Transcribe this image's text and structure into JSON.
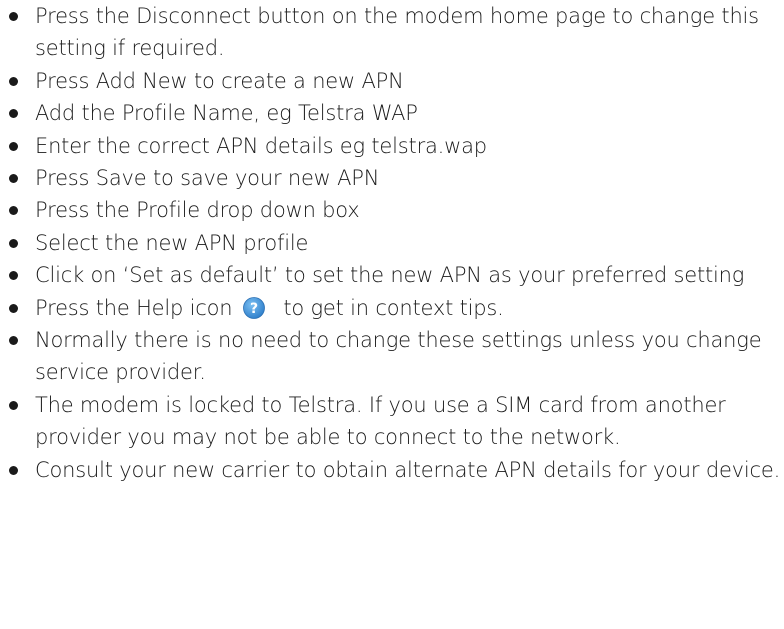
{
  "tips": [
    {
      "text": "Press the Disconnect button on the modem home page to change this setting if required."
    },
    {
      "text": "Press Add New to create a new APN"
    },
    {
      "text": "Add the Profile Name, eg Telstra WAP"
    },
    {
      "text": "Enter the correct APN details eg telstra.wap"
    },
    {
      "text": "Press Save to save your new APN"
    },
    {
      "text": "Press the Profile drop down box"
    },
    {
      "text": "Select the new APN profile"
    },
    {
      "text": "Click on ‘Set as default’ to set the new APN as your preferred setting"
    },
    {
      "text_before": "Press the Help icon",
      "icon": "help-question-icon",
      "text_after": "to get in context tips."
    },
    {
      "text": "Normally there is no need to change these settings unless you change service provider."
    },
    {
      "text": "The modem is locked to Telstra. If you use a SIM card from another provider you may not be able to connect to the network."
    },
    {
      "text": "Consult your new carrier to obtain alternate APN details for your device."
    }
  ],
  "colors": {
    "text": "#1a1a1a",
    "help_icon_fill": "#3d8fd6"
  }
}
